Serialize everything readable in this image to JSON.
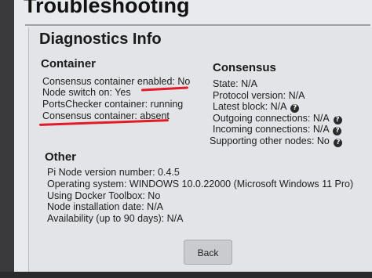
{
  "header": {
    "title": "Troubleshooting"
  },
  "diagnostics": {
    "title": "Diagnostics Info"
  },
  "container": {
    "title": "Container",
    "lines": [
      "Consensus container enabled: No",
      "Node switch on: Yes",
      "PortsChecker container: running",
      "Consensus container: absent"
    ]
  },
  "consensus": {
    "title": "Consensus",
    "lines": [
      "State: N/A",
      "Protocol version: N/A",
      "Latest block: N/A",
      "Outgoing connections: N/A",
      "Incoming connections: N/A",
      "Supporting other nodes: No"
    ],
    "help_icon": "?"
  },
  "other": {
    "title": "Other",
    "lines": [
      "Pi Node version number: 0.4.5",
      "Operating system: WINDOWS 10.0.22000 (Microsoft Windows 11 Pro)",
      "Using Docker Toolbox: No",
      "Node installation date: N/A",
      "Availability (up to 90 days): N/A"
    ]
  },
  "footer": {
    "back_label": "Back"
  },
  "annotation": {
    "underline_color": "#e21a2a"
  }
}
